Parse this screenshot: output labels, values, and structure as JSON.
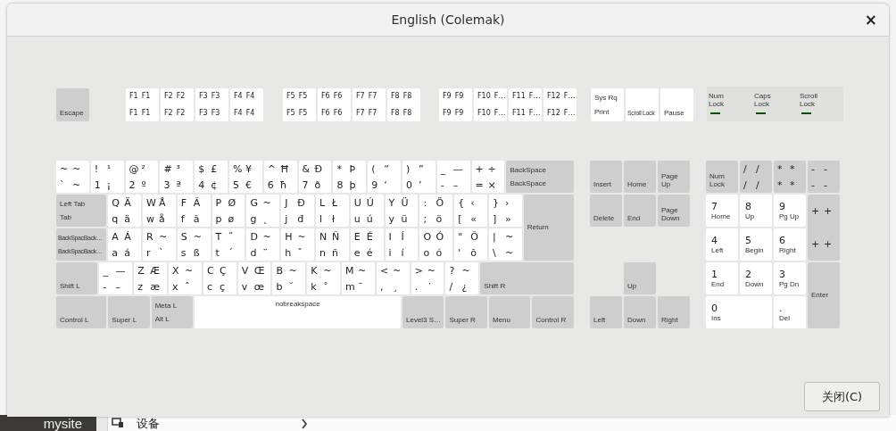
{
  "window": {
    "title": "English (Colemak)",
    "close": "×"
  },
  "function_row": [
    [
      {
        "kind": "named",
        "labels": [
          "Escape"
        ]
      }
    ],
    [
      {
        "kind": "fkey",
        "legends": [
          "F1",
          "F1",
          "F1",
          "F1"
        ]
      },
      {
        "kind": "fkey",
        "legends": [
          "F2",
          "F2",
          "F2",
          "F2"
        ]
      },
      {
        "kind": "fkey",
        "legends": [
          "F3",
          "F3",
          "F3",
          "F3"
        ]
      },
      {
        "kind": "fkey",
        "legends": [
          "F4",
          "F4",
          "F4",
          "F4"
        ]
      }
    ],
    [
      {
        "kind": "fkey",
        "legends": [
          "F5",
          "F5",
          "F5",
          "F5"
        ]
      },
      {
        "kind": "fkey",
        "legends": [
          "F6",
          "F6",
          "F6",
          "F6"
        ]
      },
      {
        "kind": "fkey",
        "legends": [
          "F7",
          "F7",
          "F7",
          "F7"
        ]
      },
      {
        "kind": "fkey",
        "legends": [
          "F8",
          "F8",
          "F8",
          "F8"
        ]
      }
    ],
    [
      {
        "kind": "fkey",
        "legends": [
          "F9",
          "F9",
          "F9",
          "F9"
        ]
      },
      {
        "kind": "fkey",
        "legends": [
          "F10",
          "F…",
          "F10",
          "F…"
        ]
      },
      {
        "kind": "fkey",
        "legends": [
          "F11",
          "F…",
          "F11",
          "F…"
        ]
      },
      {
        "kind": "fkey",
        "legends": [
          "F12",
          "F…",
          "F12",
          "F…"
        ]
      }
    ],
    [
      {
        "kind": "plain",
        "labels": [
          "Sys Rq",
          "Print"
        ]
      },
      {
        "kind": "plain",
        "labels": [
          "Scroll Lock"
        ]
      },
      {
        "kind": "plain",
        "labels": [
          "Pause"
        ]
      }
    ]
  ],
  "indicators": [
    {
      "label": "Num Lock"
    },
    {
      "label": "Caps Lock"
    },
    {
      "label": "Scroll Lock"
    }
  ],
  "main_rows": [
    [
      {
        "kind": "char",
        "legends": [
          "~",
          "~",
          "`",
          "~"
        ]
      },
      {
        "kind": "char",
        "legends": [
          "!",
          "¹",
          "1",
          "¡"
        ]
      },
      {
        "kind": "char",
        "legends": [
          "@",
          "²",
          "2",
          "º"
        ]
      },
      {
        "kind": "char",
        "legends": [
          "#",
          "³",
          "3",
          "ª"
        ]
      },
      {
        "kind": "char",
        "legends": [
          "$",
          "£",
          "4",
          "¢"
        ]
      },
      {
        "kind": "char",
        "legends": [
          "%",
          "¥",
          "5",
          "€"
        ]
      },
      {
        "kind": "char",
        "legends": [
          "^",
          "Ħ",
          "6",
          "ħ"
        ]
      },
      {
        "kind": "char",
        "legends": [
          "&",
          "Ð",
          "7",
          "ð"
        ]
      },
      {
        "kind": "char",
        "legends": [
          "*",
          "Þ",
          "8",
          "þ"
        ]
      },
      {
        "kind": "char",
        "legends": [
          "(",
          "“",
          "9",
          "‘"
        ]
      },
      {
        "kind": "char",
        "legends": [
          ")",
          "”",
          "0",
          "’"
        ]
      },
      {
        "kind": "char",
        "legends": [
          "_",
          "—",
          "-",
          "–"
        ]
      },
      {
        "kind": "char",
        "legends": [
          "+",
          "÷",
          "=",
          "×"
        ]
      },
      {
        "kind": "named",
        "labels": [
          "BackSpace",
          "BackSpace"
        ]
      }
    ],
    [
      {
        "kind": "named",
        "labels": [
          "Left Tab",
          "Tab"
        ]
      },
      {
        "kind": "char",
        "legends": [
          "Q",
          "Ä",
          "q",
          "ä"
        ]
      },
      {
        "kind": "char",
        "legends": [
          "W",
          "Å",
          "w",
          "å"
        ]
      },
      {
        "kind": "char",
        "legends": [
          "F",
          "Ã",
          "f",
          "ã"
        ]
      },
      {
        "kind": "char",
        "legends": [
          "P",
          "Ø",
          "p",
          "ø"
        ]
      },
      {
        "kind": "char",
        "legends": [
          "G",
          "~",
          "g",
          "˛"
        ]
      },
      {
        "kind": "char",
        "legends": [
          "J",
          "Đ",
          "j",
          "đ"
        ]
      },
      {
        "kind": "char",
        "legends": [
          "L",
          "Ł",
          "l",
          "ł"
        ]
      },
      {
        "kind": "char",
        "legends": [
          "U",
          "Ú",
          "u",
          "ú"
        ]
      },
      {
        "kind": "char",
        "legends": [
          "Y",
          "Ü",
          "y",
          "ü"
        ]
      },
      {
        "kind": "char",
        "legends": [
          ":",
          "Ö",
          ";",
          "ö"
        ]
      },
      {
        "kind": "char",
        "legends": [
          "{",
          "‹",
          "[",
          "«"
        ]
      },
      {
        "kind": "char",
        "legends": [
          "}",
          "›",
          "]",
          "»"
        ]
      },
      {
        "kind": "named",
        "labels": [
          "Return"
        ]
      }
    ],
    [
      {
        "kind": "named",
        "labels": [
          "BackSpacBack…",
          "BackSpacBack…"
        ]
      },
      {
        "kind": "char",
        "legends": [
          "A",
          "Á",
          "a",
          "á"
        ]
      },
      {
        "kind": "char",
        "legends": [
          "R",
          "~",
          "r",
          "`"
        ]
      },
      {
        "kind": "char",
        "legends": [
          "S",
          "~",
          "s",
          "ß"
        ]
      },
      {
        "kind": "char",
        "legends": [
          "T",
          "˝",
          "t",
          "´"
        ]
      },
      {
        "kind": "char",
        "legends": [
          "D",
          "~",
          "d",
          "¨"
        ]
      },
      {
        "kind": "char",
        "legends": [
          "H",
          "~",
          "h",
          "ˇ"
        ]
      },
      {
        "kind": "char",
        "legends": [
          "N",
          "Ñ",
          "n",
          "ñ"
        ]
      },
      {
        "kind": "char",
        "legends": [
          "E",
          "É",
          "e",
          "é"
        ]
      },
      {
        "kind": "char",
        "legends": [
          "I",
          "Í",
          "i",
          "í"
        ]
      },
      {
        "kind": "char",
        "legends": [
          "O",
          "Ó",
          "o",
          "ó"
        ]
      },
      {
        "kind": "char",
        "legends": [
          "\"",
          "Õ",
          "'",
          "õ"
        ]
      },
      {
        "kind": "char",
        "legends": [
          "|",
          "~",
          "\\",
          "~"
        ]
      }
    ],
    [
      {
        "kind": "named",
        "labels": [
          "Shift L"
        ]
      },
      {
        "kind": "char",
        "legends": [
          "_",
          "—",
          "-",
          "–"
        ]
      },
      {
        "kind": "char",
        "legends": [
          "Z",
          "Æ",
          "z",
          "æ"
        ]
      },
      {
        "kind": "char",
        "legends": [
          "X",
          "~",
          "x",
          "ˆ"
        ]
      },
      {
        "kind": "char",
        "legends": [
          "C",
          "Ç",
          "c",
          "ç"
        ]
      },
      {
        "kind": "char",
        "legends": [
          "V",
          "Œ",
          "v",
          "œ"
        ]
      },
      {
        "kind": "char",
        "legends": [
          "B",
          "~",
          "b",
          "˘"
        ]
      },
      {
        "kind": "char",
        "legends": [
          "K",
          "~",
          "k",
          "˚"
        ]
      },
      {
        "kind": "char",
        "legends": [
          "M",
          "~",
          "m",
          "¯"
        ]
      },
      {
        "kind": "char",
        "legends": [
          "<",
          "~",
          ",",
          "¸"
        ]
      },
      {
        "kind": "char",
        "legends": [
          ">",
          "~",
          ".",
          "˙"
        ]
      },
      {
        "kind": "char",
        "legends": [
          "?",
          "~",
          "/",
          "¿"
        ]
      },
      {
        "kind": "named",
        "labels": [
          "Shift R"
        ]
      }
    ],
    [
      {
        "kind": "named",
        "labels": [
          "Control L"
        ]
      },
      {
        "kind": "named",
        "labels": [
          "Super L"
        ]
      },
      {
        "kind": "named",
        "labels": [
          "Meta L",
          "Alt L"
        ]
      },
      {
        "kind": "space",
        "labels": [
          "nobreakspace"
        ]
      },
      {
        "kind": "named",
        "labels": [
          "Level3 S…"
        ]
      },
      {
        "kind": "named",
        "labels": [
          "Super R"
        ]
      },
      {
        "kind": "named",
        "labels": [
          "Menu"
        ]
      },
      {
        "kind": "named",
        "labels": [
          "Control R"
        ]
      }
    ]
  ],
  "nav_keys": [
    {
      "kind": "named",
      "labels": [
        "Insert"
      ]
    },
    {
      "kind": "named",
      "labels": [
        "Home"
      ]
    },
    {
      "kind": "named",
      "labels": [
        "Page Up"
      ]
    },
    {
      "kind": "named",
      "labels": [
        "Delete"
      ]
    },
    {
      "kind": "named",
      "labels": [
        "End"
      ]
    },
    {
      "kind": "named",
      "labels": [
        "Page Down"
      ]
    },
    {
      "kind": "named",
      "labels": [
        "Up"
      ]
    },
    {
      "kind": "named",
      "labels": [
        "Left"
      ]
    },
    {
      "kind": "named",
      "labels": [
        "Down"
      ]
    },
    {
      "kind": "named",
      "labels": [
        "Right"
      ]
    }
  ],
  "numpad": [
    {
      "kind": "named",
      "labels": [
        "Num Lock"
      ]
    },
    {
      "kind": "pad-char",
      "legends": [
        "/",
        "/",
        "/",
        "/"
      ]
    },
    {
      "kind": "pad-char",
      "legends": [
        "*",
        "*",
        "*",
        "*"
      ]
    },
    {
      "kind": "pad-char",
      "legends": [
        "-",
        "-",
        "-",
        "-"
      ]
    },
    {
      "kind": "numpad",
      "digit": "7",
      "label": "Home"
    },
    {
      "kind": "numpad",
      "digit": "8",
      "label": "Up"
    },
    {
      "kind": "numpad",
      "digit": "9",
      "label": "Pg Up"
    },
    {
      "kind": "pad-char",
      "legends": [
        "+",
        "+",
        "+",
        "+"
      ]
    },
    {
      "kind": "numpad",
      "digit": "4",
      "label": "Left"
    },
    {
      "kind": "numpad",
      "digit": "5",
      "label": "Begin"
    },
    {
      "kind": "numpad",
      "digit": "6",
      "label": "Right"
    },
    {
      "kind": "numpad",
      "digit": "1",
      "label": "End"
    },
    {
      "kind": "numpad",
      "digit": "2",
      "label": "Down"
    },
    {
      "kind": "numpad",
      "digit": "3",
      "label": "Pg Dn"
    },
    {
      "kind": "named",
      "labels": [
        "Enter"
      ]
    },
    {
      "kind": "numpad",
      "digit": "0",
      "label": "Ins"
    },
    {
      "kind": "numpad",
      "digit": ".",
      "label": "Del"
    }
  ],
  "buttons": [
    "关闭(C)"
  ],
  "background": {
    "sidebar_label": "mysite",
    "list_item": "设备"
  }
}
